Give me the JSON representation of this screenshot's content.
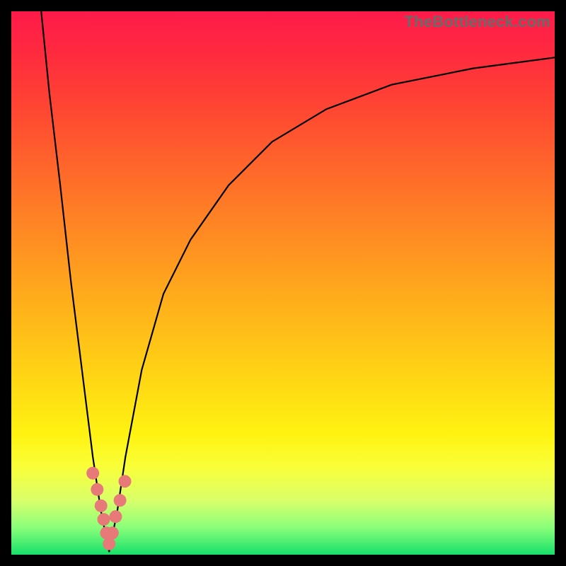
{
  "watermark": "TheBottleneck.com",
  "chart_data": {
    "type": "line",
    "title": "",
    "xlabel": "",
    "ylabel": "",
    "xlim": [
      0,
      100
    ],
    "ylim": [
      0,
      100
    ],
    "grid": false,
    "legend": false,
    "notes": "Axes are unlabeled; values are estimated from pixel positions. Curve is a V-shaped bottleneck curve with minimum near x≈18, y≈0. Background gradient runs red→green top→bottom. Markers (salmon dots) cluster along the curve bottom between roughly y≈9 and y≈15.",
    "series": [
      {
        "name": "bottleneck-curve",
        "x": [
          5.5,
          7,
          9,
          11,
          13,
          15,
          16.5,
          18,
          19.5,
          21,
          24,
          28,
          33,
          40,
          48,
          58,
          70,
          85,
          100
        ],
        "y": [
          100,
          85,
          68,
          50,
          34,
          18,
          8,
          0.5,
          8,
          18,
          34,
          48,
          58,
          68,
          76,
          82,
          86.5,
          89.5,
          91.5
        ]
      }
    ],
    "markers": {
      "name": "highlighted-range",
      "points": [
        {
          "x": 15.0,
          "y": 15.0
        },
        {
          "x": 15.8,
          "y": 12.0
        },
        {
          "x": 16.5,
          "y": 9.0
        },
        {
          "x": 17.0,
          "y": 6.5
        },
        {
          "x": 17.5,
          "y": 4.0
        },
        {
          "x": 18.0,
          "y": 2.0
        },
        {
          "x": 18.6,
          "y": 4.0
        },
        {
          "x": 19.2,
          "y": 7.0
        },
        {
          "x": 20.0,
          "y": 10.0
        },
        {
          "x": 20.9,
          "y": 13.5
        }
      ]
    },
    "colors": {
      "curve": "#000000",
      "marker": "#e77a78",
      "gradient_top": "#ff1a4a",
      "gradient_bottom": "#16e06a",
      "frame": "#000000"
    }
  }
}
